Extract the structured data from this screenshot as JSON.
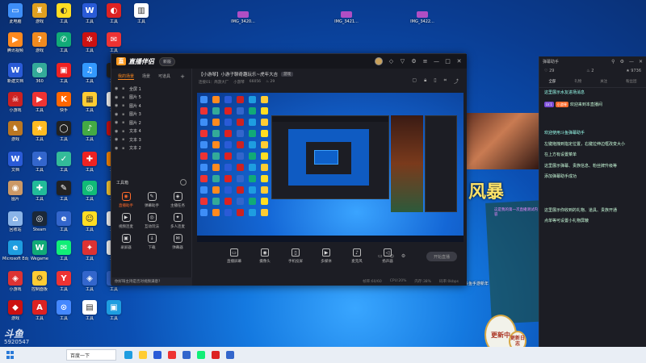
{
  "desktop": {
    "icons": [
      {
        "label": "此电脑",
        "color": "#3e8ef7",
        "glyph": "▭"
      },
      {
        "label": "腾讯视频",
        "color": "#ff8a1f",
        "glyph": "▶"
      },
      {
        "label": "新建文档",
        "color": "#2a5bd7",
        "glyph": "W"
      },
      {
        "label": "小游戏",
        "color": "#c22",
        "glyph": "☠"
      },
      {
        "label": "游戏",
        "color": "#b72",
        "glyph": "♞"
      },
      {
        "label": "文档",
        "color": "#2a5bd7",
        "glyph": "W"
      },
      {
        "label": "图片",
        "color": "#c96",
        "glyph": "◉"
      },
      {
        "label": "回收站",
        "color": "#8ab4e8",
        "glyph": "⌂"
      },
      {
        "label": "Microsoft Edge",
        "color": "#1e9de0",
        "glyph": "e"
      },
      {
        "label": "小游戏",
        "color": "#d33",
        "glyph": "◈"
      },
      {
        "label": "游戏",
        "color": "#c11",
        "glyph": "◆"
      },
      {
        "label": "游戏",
        "color": "#e0a020",
        "glyph": "♜"
      },
      {
        "label": "游戏",
        "color": "#f08a1f",
        "glyph": "?"
      },
      {
        "label": "360",
        "color": "#3a9",
        "glyph": "⊕"
      },
      {
        "label": "工具",
        "color": "#e33",
        "glyph": "▶"
      },
      {
        "label": "工具",
        "color": "#fb2",
        "glyph": "★"
      },
      {
        "label": "工具",
        "color": "#36c",
        "glyph": "✦"
      },
      {
        "label": "工具",
        "color": "#2b9",
        "glyph": "✚"
      },
      {
        "label": "Steam",
        "color": "#1b2838",
        "glyph": "◎"
      },
      {
        "label": "Wegame",
        "color": "#1a7",
        "glyph": "W"
      },
      {
        "label": "控制面板",
        "color": "#fc3",
        "glyph": "⚙"
      },
      {
        "label": "工具",
        "color": "#d22",
        "glyph": "A"
      },
      {
        "label": "工具",
        "color": "#fd2",
        "glyph": "◐"
      },
      {
        "label": "工具",
        "color": "#1a7",
        "glyph": "✆"
      },
      {
        "label": "工具",
        "color": "#e22",
        "glyph": "▣"
      },
      {
        "label": "快手",
        "color": "#f60",
        "glyph": "K"
      },
      {
        "label": "工具",
        "color": "#222",
        "glyph": "◯"
      },
      {
        "label": "工具",
        "color": "#3b9",
        "glyph": "✓"
      },
      {
        "label": "工具",
        "color": "#222",
        "glyph": "✎"
      },
      {
        "label": "工具",
        "color": "#36c",
        "glyph": "e"
      },
      {
        "label": "工具",
        "color": "#1e7",
        "glyph": "✉"
      },
      {
        "label": "工具",
        "color": "#e33",
        "glyph": "Y"
      },
      {
        "label": "工具",
        "color": "#48f",
        "glyph": "⊙"
      },
      {
        "label": "工具",
        "color": "#2a5bd7",
        "glyph": "W"
      },
      {
        "label": "工具",
        "color": "#c11",
        "glyph": "✲"
      },
      {
        "label": "工具",
        "color": "#39f",
        "glyph": "♫"
      },
      {
        "label": "工具",
        "color": "#fc3",
        "glyph": "▦"
      },
      {
        "label": "工具",
        "color": "#4a4",
        "glyph": "♪"
      },
      {
        "label": "工具",
        "color": "#e22",
        "glyph": "✚"
      },
      {
        "label": "工具",
        "color": "#1b7",
        "glyph": "◎"
      },
      {
        "label": "工具",
        "color": "#fd2",
        "glyph": "☺"
      },
      {
        "label": "工具",
        "color": "#d33",
        "glyph": "✦"
      },
      {
        "label": "工具",
        "color": "#36c",
        "glyph": "◈"
      },
      {
        "label": "工具",
        "color": "#fff",
        "glyph": "▤"
      },
      {
        "label": "工具",
        "color": "#d22",
        "glyph": "◐"
      },
      {
        "label": "工具",
        "color": "#e33",
        "glyph": "✉"
      },
      {
        "label": "工具",
        "color": "#222",
        "glyph": "♞"
      },
      {
        "label": "工具",
        "color": "#fff",
        "glyph": "▥"
      },
      {
        "label": "工具",
        "color": "#c11",
        "glyph": "◎"
      },
      {
        "label": "工具",
        "color": "#f80",
        "glyph": "☀"
      },
      {
        "label": "工具",
        "color": "#fc3",
        "glyph": "✿"
      },
      {
        "label": "工具",
        "color": "#fff",
        "glyph": "▤"
      },
      {
        "label": "工具",
        "color": "#fff",
        "glyph": "▤"
      },
      {
        "label": "工具",
        "color": "#36c",
        "glyph": "◆"
      },
      {
        "label": "工具",
        "color": "#1e9de0",
        "glyph": "▣"
      },
      {
        "label": "工具",
        "color": "#fff",
        "glyph": "▥"
      }
    ],
    "top_files": [
      {
        "label": "IMG_3420..."
      },
      {
        "label": "IMG_3421..."
      },
      {
        "label": "IMG_3422..."
      }
    ]
  },
  "app": {
    "logo_text": "直播伴侣",
    "version_badge": "新版",
    "left_tabs": [
      "我的场景",
      "场景",
      "可道具"
    ],
    "sources": [
      "全屏 1",
      "图片 5",
      "图片 4",
      "图片 3",
      "图片 2",
      "文本 4",
      "文本 3",
      "文本 2"
    ],
    "tools_heading": "工具箱",
    "tools": [
      {
        "label": "直播助手",
        "glyph": "◉",
        "highlight": true
      },
      {
        "label": "弹幕助手",
        "glyph": "✎",
        "highlight": false
      },
      {
        "label": "主播任务",
        "glyph": "◈",
        "highlight": false
      },
      {
        "label": "视频连麦",
        "glyph": "▶",
        "highlight": false
      },
      {
        "label": "互动玩法",
        "glyph": "◎",
        "highlight": false
      },
      {
        "label": "多人连麦",
        "glyph": "✦",
        "highlight": false
      },
      {
        "label": "录屏器",
        "glyph": "▣",
        "highlight": false
      },
      {
        "label": "下载",
        "glyph": "↓",
        "highlight": false
      },
      {
        "label": "弹幕器",
        "glyph": "✉",
        "highlight": false
      }
    ],
    "notice": "你好呀主持是否对视频满意?",
    "stream_title": "【小游琴】小游子聊奇趣玩乐~虎年大吉",
    "stream_tag": "游戏",
    "stream_meta": [
      "连接01：简游大厂",
      "小游琴",
      "66056"
    ],
    "stream_viewers": "29",
    "actions": [
      {
        "label": "直播屏幕",
        "glyph": "▭"
      },
      {
        "label": "摄像头",
        "glyph": "◉"
      },
      {
        "label": "手机投屏",
        "glyph": "▯"
      },
      {
        "label": "多媒体",
        "glyph": "▶"
      },
      {
        "label": "麦克风",
        "glyph": "♪"
      },
      {
        "label": "扬声器",
        "glyph": "◁"
      }
    ],
    "start_button": "开始直播",
    "status": [
      "帧率:60/60",
      "CPU:20%",
      "内存:38%",
      "码率:0kbps"
    ]
  },
  "chat": {
    "title": "弹幕助手",
    "stats": [
      "♡ 29",
      "♨ 2",
      "★ 9736"
    ],
    "tabs": [
      "全部",
      "礼物",
      "关注",
      "粉丝团"
    ],
    "messages": [
      {
        "text": "这里展示水友进场消息",
        "sys": true
      },
      {
        "badge": "LV.1",
        "badge2": "小游琴",
        "text": "欢迎来到本直播间"
      },
      {
        "text": "欢迎使用斗鱼弹幕助手",
        "sys": true
      },
      {
        "text": "左键拖拽到指定位置，右键拉伸边框改变大小"
      },
      {
        "text": "在上方有设置菜单"
      },
      {
        "text": "这里展示弹幕、贵族信息、粉丝牌升级等"
      },
      {
        "text": "添加弹幕助手成功"
      },
      {
        "text": "这里展示你收到的礼物、道具、贵族开通"
      },
      {
        "text": "点单等可设置小礼物屏蔽"
      }
    ]
  },
  "poster": {
    "title": "风暴",
    "tag": "斗鱼手游新年",
    "note": "这是我的第一次直播测试内容",
    "gear1": "更新中",
    "gear2": "更新日志"
  },
  "watermark": {
    "logo": "斗鱼",
    "room_id": "5920547"
  },
  "taskbar": {
    "search_placeholder": "百度一下",
    "app_colors": [
      "#1e9de0",
      "#fc3",
      "#2a5bd7",
      "#e33",
      "#36c",
      "#1e7",
      "#d22",
      "#36c"
    ]
  }
}
